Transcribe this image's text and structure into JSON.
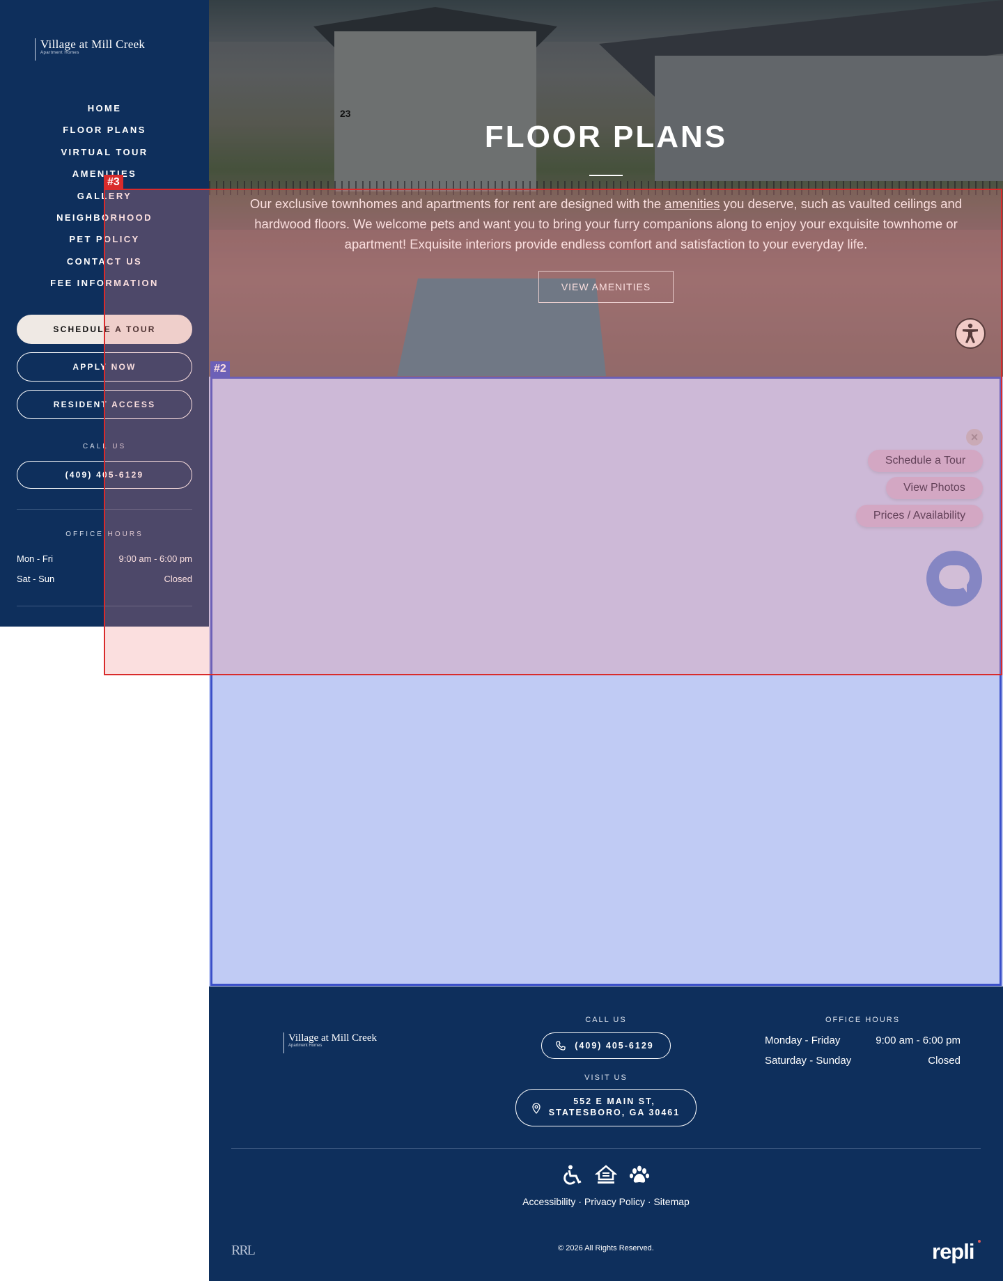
{
  "brand": {
    "name": "Village at Mill Creek",
    "tagline": "Apartment Homes"
  },
  "sidebar": {
    "nav": [
      {
        "label": "HOME"
      },
      {
        "label": "FLOOR PLANS"
      },
      {
        "label": "VIRTUAL TOUR"
      },
      {
        "label": "AMENITIES"
      },
      {
        "label": "GALLERY"
      },
      {
        "label": "NEIGHBORHOOD"
      },
      {
        "label": "PET POLICY"
      },
      {
        "label": "CONTACT US"
      },
      {
        "label": "FEE INFORMATION"
      }
    ],
    "schedule_label": "SCHEDULE A TOUR",
    "apply_label": "APPLY NOW",
    "resident_label": "RESIDENT ACCESS",
    "call_label": "CALL US",
    "phone": "(409) 405-6129",
    "hours_label": "OFFICE HOURS",
    "hours": [
      {
        "days": "Mon - Fri",
        "time": "9:00 am - 6:00 pm"
      },
      {
        "days": "Sat - Sun",
        "time": "Closed"
      }
    ]
  },
  "hero": {
    "title": "FLOOR PLANS",
    "text_before": "Our exclusive townhomes and apartments for rent are designed with the ",
    "text_link": "amenities",
    "text_after": " you deserve, such as vaulted ceilings and hardwood floors. We welcome pets and want you to bring your furry companions along to enjoy your exquisite townhome or apartment! Exquisite interiors provide endless comfort and satisfaction to your everyday life.",
    "button_label": "VIEW AMENITIES",
    "photo_number": "23"
  },
  "widget": {
    "close_symbol": "×",
    "options": [
      "Schedule a Tour",
      "View Photos",
      "Prices / Availability"
    ]
  },
  "footer": {
    "call_label": "CALL US",
    "phone": "(409) 405-6129",
    "visit_label": "VISIT US",
    "address_line1": "552 E MAIN ST,",
    "address_line2": "STATESBORO, GA 30461",
    "hours_label": "OFFICE HOURS",
    "hours": [
      {
        "days": "Monday - Friday",
        "time": "9:00 am - 6:00 pm"
      },
      {
        "days": "Saturday - Sunday",
        "time": "Closed"
      }
    ],
    "links": [
      "Accessibility",
      "Privacy Policy",
      "Sitemap"
    ],
    "separator": "·",
    "copyright": "© 2026 All Rights Reserved.",
    "management_logo": "RRL",
    "vendor_logo": "repli"
  },
  "annotations": [
    {
      "label": "#3",
      "color": "#d92b2b"
    },
    {
      "label": "#2",
      "color": "#3a4fc8"
    }
  ],
  "icons": [
    "accessibility-icon",
    "phone-icon",
    "location-pin-icon",
    "wheelchair-icon",
    "equal-housing-icon",
    "paw-icon",
    "chat-icon"
  ]
}
